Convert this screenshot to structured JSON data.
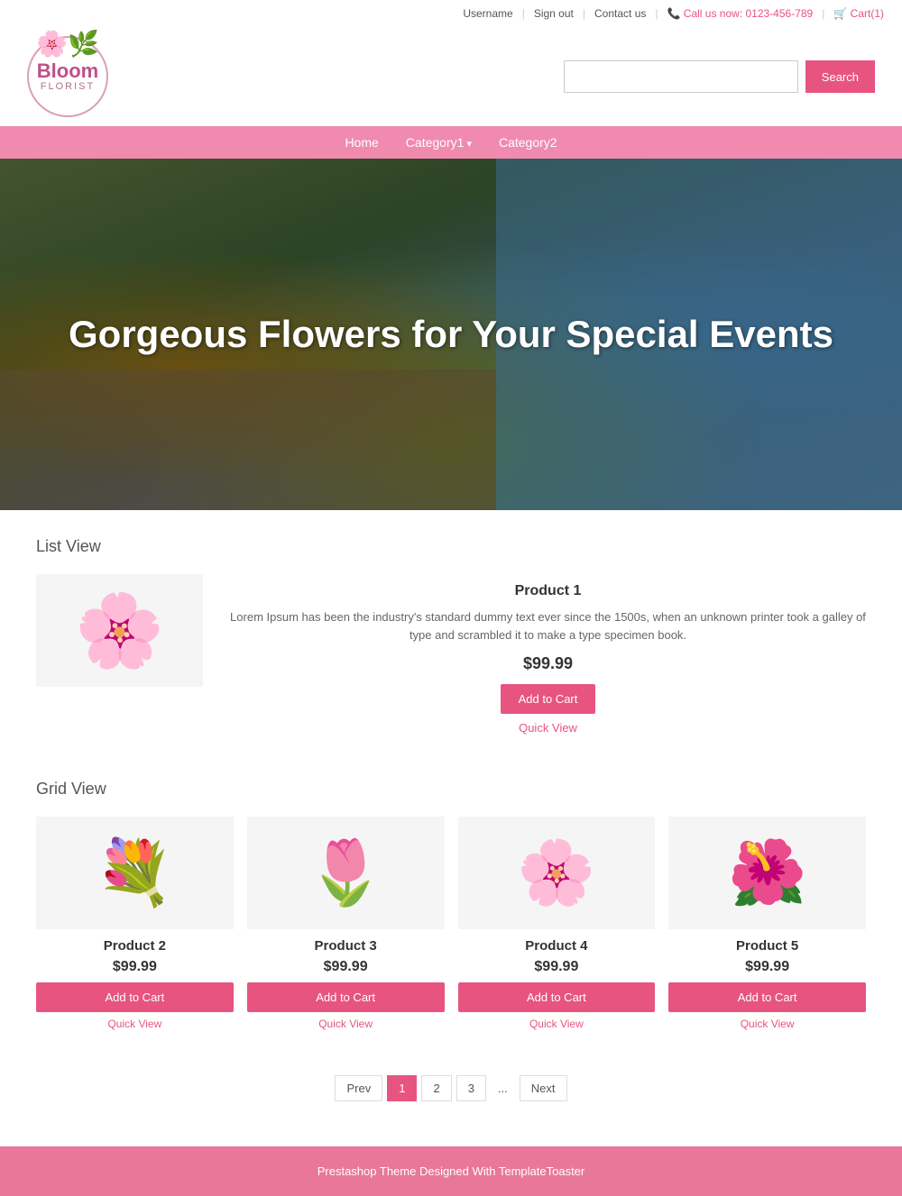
{
  "topbar": {
    "username": "Username",
    "signout": "Sign out",
    "contact": "Contact us",
    "phone_icon": "📞",
    "phone": "Call us now: 0123-456-789",
    "cart_icon": "🛒",
    "cart": "Cart(1)"
  },
  "logo": {
    "bloom": "Bloom",
    "florist": "FLORIST"
  },
  "search": {
    "placeholder": "",
    "button_label": "Search"
  },
  "nav": {
    "home": "Home",
    "cat1": "Category1",
    "cat2": "Category2"
  },
  "hero": {
    "title": "Gorgeous Flowers for Your Special Events"
  },
  "list_view": {
    "title": "List View",
    "product": {
      "name": "Product 1",
      "desc": "Lorem Ipsum has been the industry's standard dummy text ever since the 1500s, when an unknown printer took a galley of type and scrambled it to make a type specimen book.",
      "price": "$99.99",
      "add_to_cart": "Add to Cart",
      "quick_view": "Quick View",
      "flower_emoji": "🌸"
    }
  },
  "grid_view": {
    "title": "Grid View",
    "products": [
      {
        "name": "Product 2",
        "price": "$99.99",
        "add_to_cart": "Add to Cart",
        "quick_view": "Quick View",
        "flower_emoji": "💐"
      },
      {
        "name": "Product 3",
        "price": "$99.99",
        "add_to_cart": "Add to Cart",
        "quick_view": "Quick View",
        "flower_emoji": "🌷"
      },
      {
        "name": "Product 4",
        "price": "$99.99",
        "add_to_cart": "Add to Cart",
        "quick_view": "Quick View",
        "flower_emoji": "🌸"
      },
      {
        "name": "Product 5",
        "price": "$99.99",
        "add_to_cart": "Add to Cart",
        "quick_view": "Quick View",
        "flower_emoji": "🌺"
      }
    ]
  },
  "pagination": {
    "prev": "Prev",
    "pages": [
      "1",
      "2",
      "3"
    ],
    "dots": "...",
    "next": "Next"
  },
  "footer": {
    "text": "Prestashop Theme Designed With TemplateToaster"
  }
}
